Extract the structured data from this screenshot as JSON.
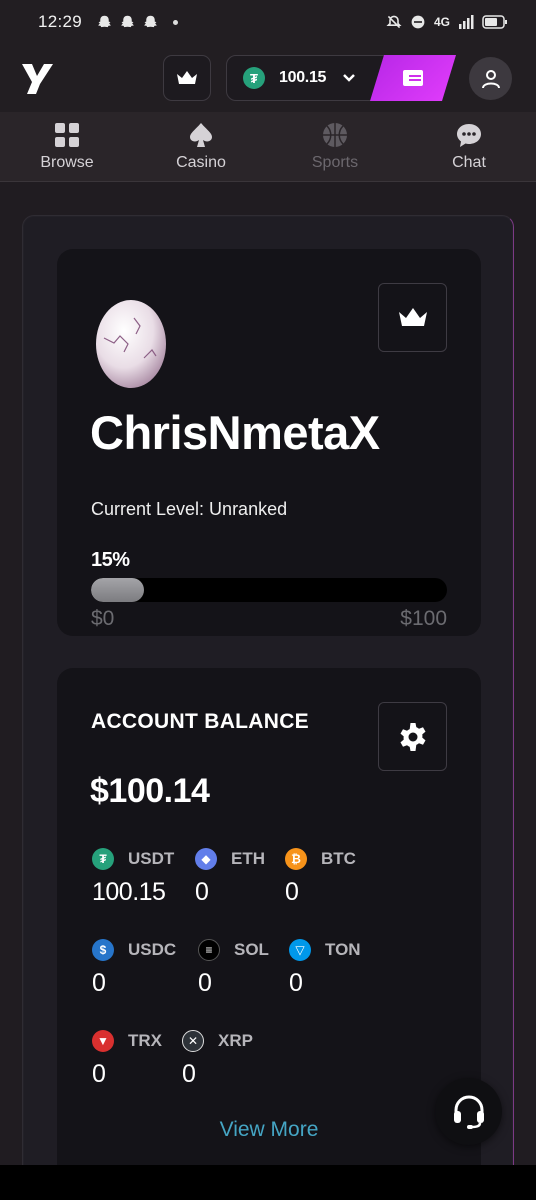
{
  "status_bar": {
    "time": "12:29",
    "network": "4G"
  },
  "header": {
    "balance_amount": "100.15",
    "balance_currency_icon": "tether-icon"
  },
  "nav": {
    "tabs": [
      {
        "label": "Browse",
        "icon": "grid-icon",
        "active": true
      },
      {
        "label": "Casino",
        "icon": "spade-icon",
        "active": true
      },
      {
        "label": "Sports",
        "icon": "basketball-icon",
        "active": false
      },
      {
        "label": "Chat",
        "icon": "chat-bubble-icon",
        "active": true
      }
    ]
  },
  "profile": {
    "username": "ChrisNmetaX",
    "level_text": "Current Level: Unranked",
    "progress_label": "15%",
    "progress_fraction": 0.15,
    "progress_min": "$0",
    "progress_max": "$100"
  },
  "account": {
    "title": "ACCOUNT BALANCE",
    "total": "$100.14",
    "assets": [
      {
        "symbol": "USDT",
        "value": "100.15",
        "color": "#26a17b",
        "glyph": "₮"
      },
      {
        "symbol": "ETH",
        "value": "0",
        "color": "#627eea",
        "glyph": "◆"
      },
      {
        "symbol": "BTC",
        "value": "0",
        "color": "#f7931a",
        "glyph": "₿"
      },
      {
        "symbol": "USDC",
        "value": "0",
        "color": "#2775ca",
        "glyph": "$"
      },
      {
        "symbol": "SOL",
        "value": "0",
        "color": "#000000",
        "glyph": "≡"
      },
      {
        "symbol": "TON",
        "value": "0",
        "color": "#0098ea",
        "glyph": "▽"
      },
      {
        "symbol": "TRX",
        "value": "0",
        "color": "#d9302f",
        "glyph": "▼"
      },
      {
        "symbol": "XRP",
        "value": "0",
        "color": "#23292f",
        "glyph": "✕"
      }
    ],
    "view_more": "View More"
  },
  "colors": {
    "accent": "#d633f2",
    "link": "#45a5c4",
    "background": "#201c21",
    "card": "#141318"
  }
}
